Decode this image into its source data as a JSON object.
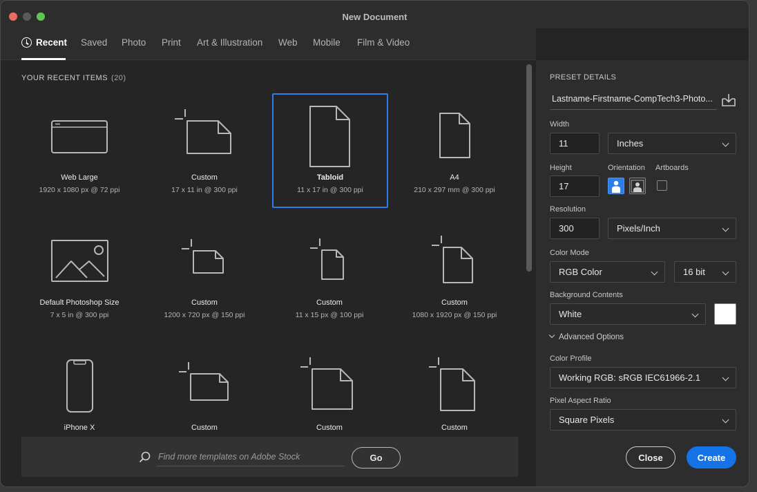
{
  "window": {
    "title": "New Document"
  },
  "tabs": [
    {
      "label": "Recent",
      "active": true
    },
    {
      "label": "Saved"
    },
    {
      "label": "Photo"
    },
    {
      "label": "Print"
    },
    {
      "label": "Art & Illustration"
    },
    {
      "label": "Web"
    },
    {
      "label": "Mobile"
    },
    {
      "label": "Film & Video"
    }
  ],
  "recent": {
    "heading": "YOUR RECENT ITEMS",
    "count": "(20)",
    "items": [
      {
        "name": "Web Large",
        "dims": "1920 x 1080 px @ 72 ppi",
        "icon": "web-large-icon"
      },
      {
        "name": "Custom",
        "dims": "17 x 11 in @ 300 ppi",
        "icon": "custom-document-icon"
      },
      {
        "name": "Tabloid",
        "dims": "11 x 17 in @ 300 ppi",
        "icon": "tabloid-document-icon",
        "selected": true
      },
      {
        "name": "A4",
        "dims": "210 x 297 mm @ 300 ppi",
        "icon": "a4-document-icon"
      },
      {
        "name": "Default Photoshop Size",
        "dims": "7 x 5 in @ 300 ppi",
        "icon": "photo-landscape-icon"
      },
      {
        "name": "Custom",
        "dims": "1200 x 720 px @ 150 ppi",
        "icon": "custom-document-icon"
      },
      {
        "name": "Custom",
        "dims": "11 x 15 px @ 100 ppi",
        "icon": "custom-document-icon"
      },
      {
        "name": "Custom",
        "dims": "1080 x 1920 px @ 150 ppi",
        "icon": "custom-document-icon"
      },
      {
        "name": "iPhone X",
        "dims": "",
        "icon": "iphone-icon"
      },
      {
        "name": "Custom",
        "dims": "",
        "icon": "custom-document-icon"
      },
      {
        "name": "Custom",
        "dims": "",
        "icon": "custom-document-icon"
      },
      {
        "name": "Custom",
        "dims": "",
        "icon": "custom-document-icon"
      }
    ]
  },
  "search": {
    "placeholder": "Find more templates on Adobe Stock",
    "go_label": "Go"
  },
  "preset": {
    "section_label": "PRESET DETAILS",
    "name": "Lastname-Firstname-CompTech3-Photo...",
    "width_label": "Width",
    "width_value": "11",
    "width_unit": "Inches",
    "height_label": "Height",
    "height_value": "17",
    "orientation_label": "Orientation",
    "orientation": "portrait",
    "artboards_label": "Artboards",
    "artboards_checked": false,
    "resolution_label": "Resolution",
    "resolution_value": "300",
    "resolution_unit": "Pixels/Inch",
    "color_mode_label": "Color Mode",
    "color_mode": "RGB Color",
    "bit_depth": "16 bit",
    "background_label": "Background Contents",
    "background": "White",
    "background_swatch": "#ffffff",
    "advanced_label": "Advanced Options",
    "color_profile_label": "Color Profile",
    "color_profile": "Working RGB: sRGB IEC61966-2.1",
    "pixel_aspect_label": "Pixel Aspect Ratio",
    "pixel_aspect": "Square Pixels"
  },
  "actions": {
    "close_label": "Close",
    "create_label": "Create"
  },
  "colors": {
    "accent": "#1473e6",
    "selection": "#2b7de9"
  }
}
